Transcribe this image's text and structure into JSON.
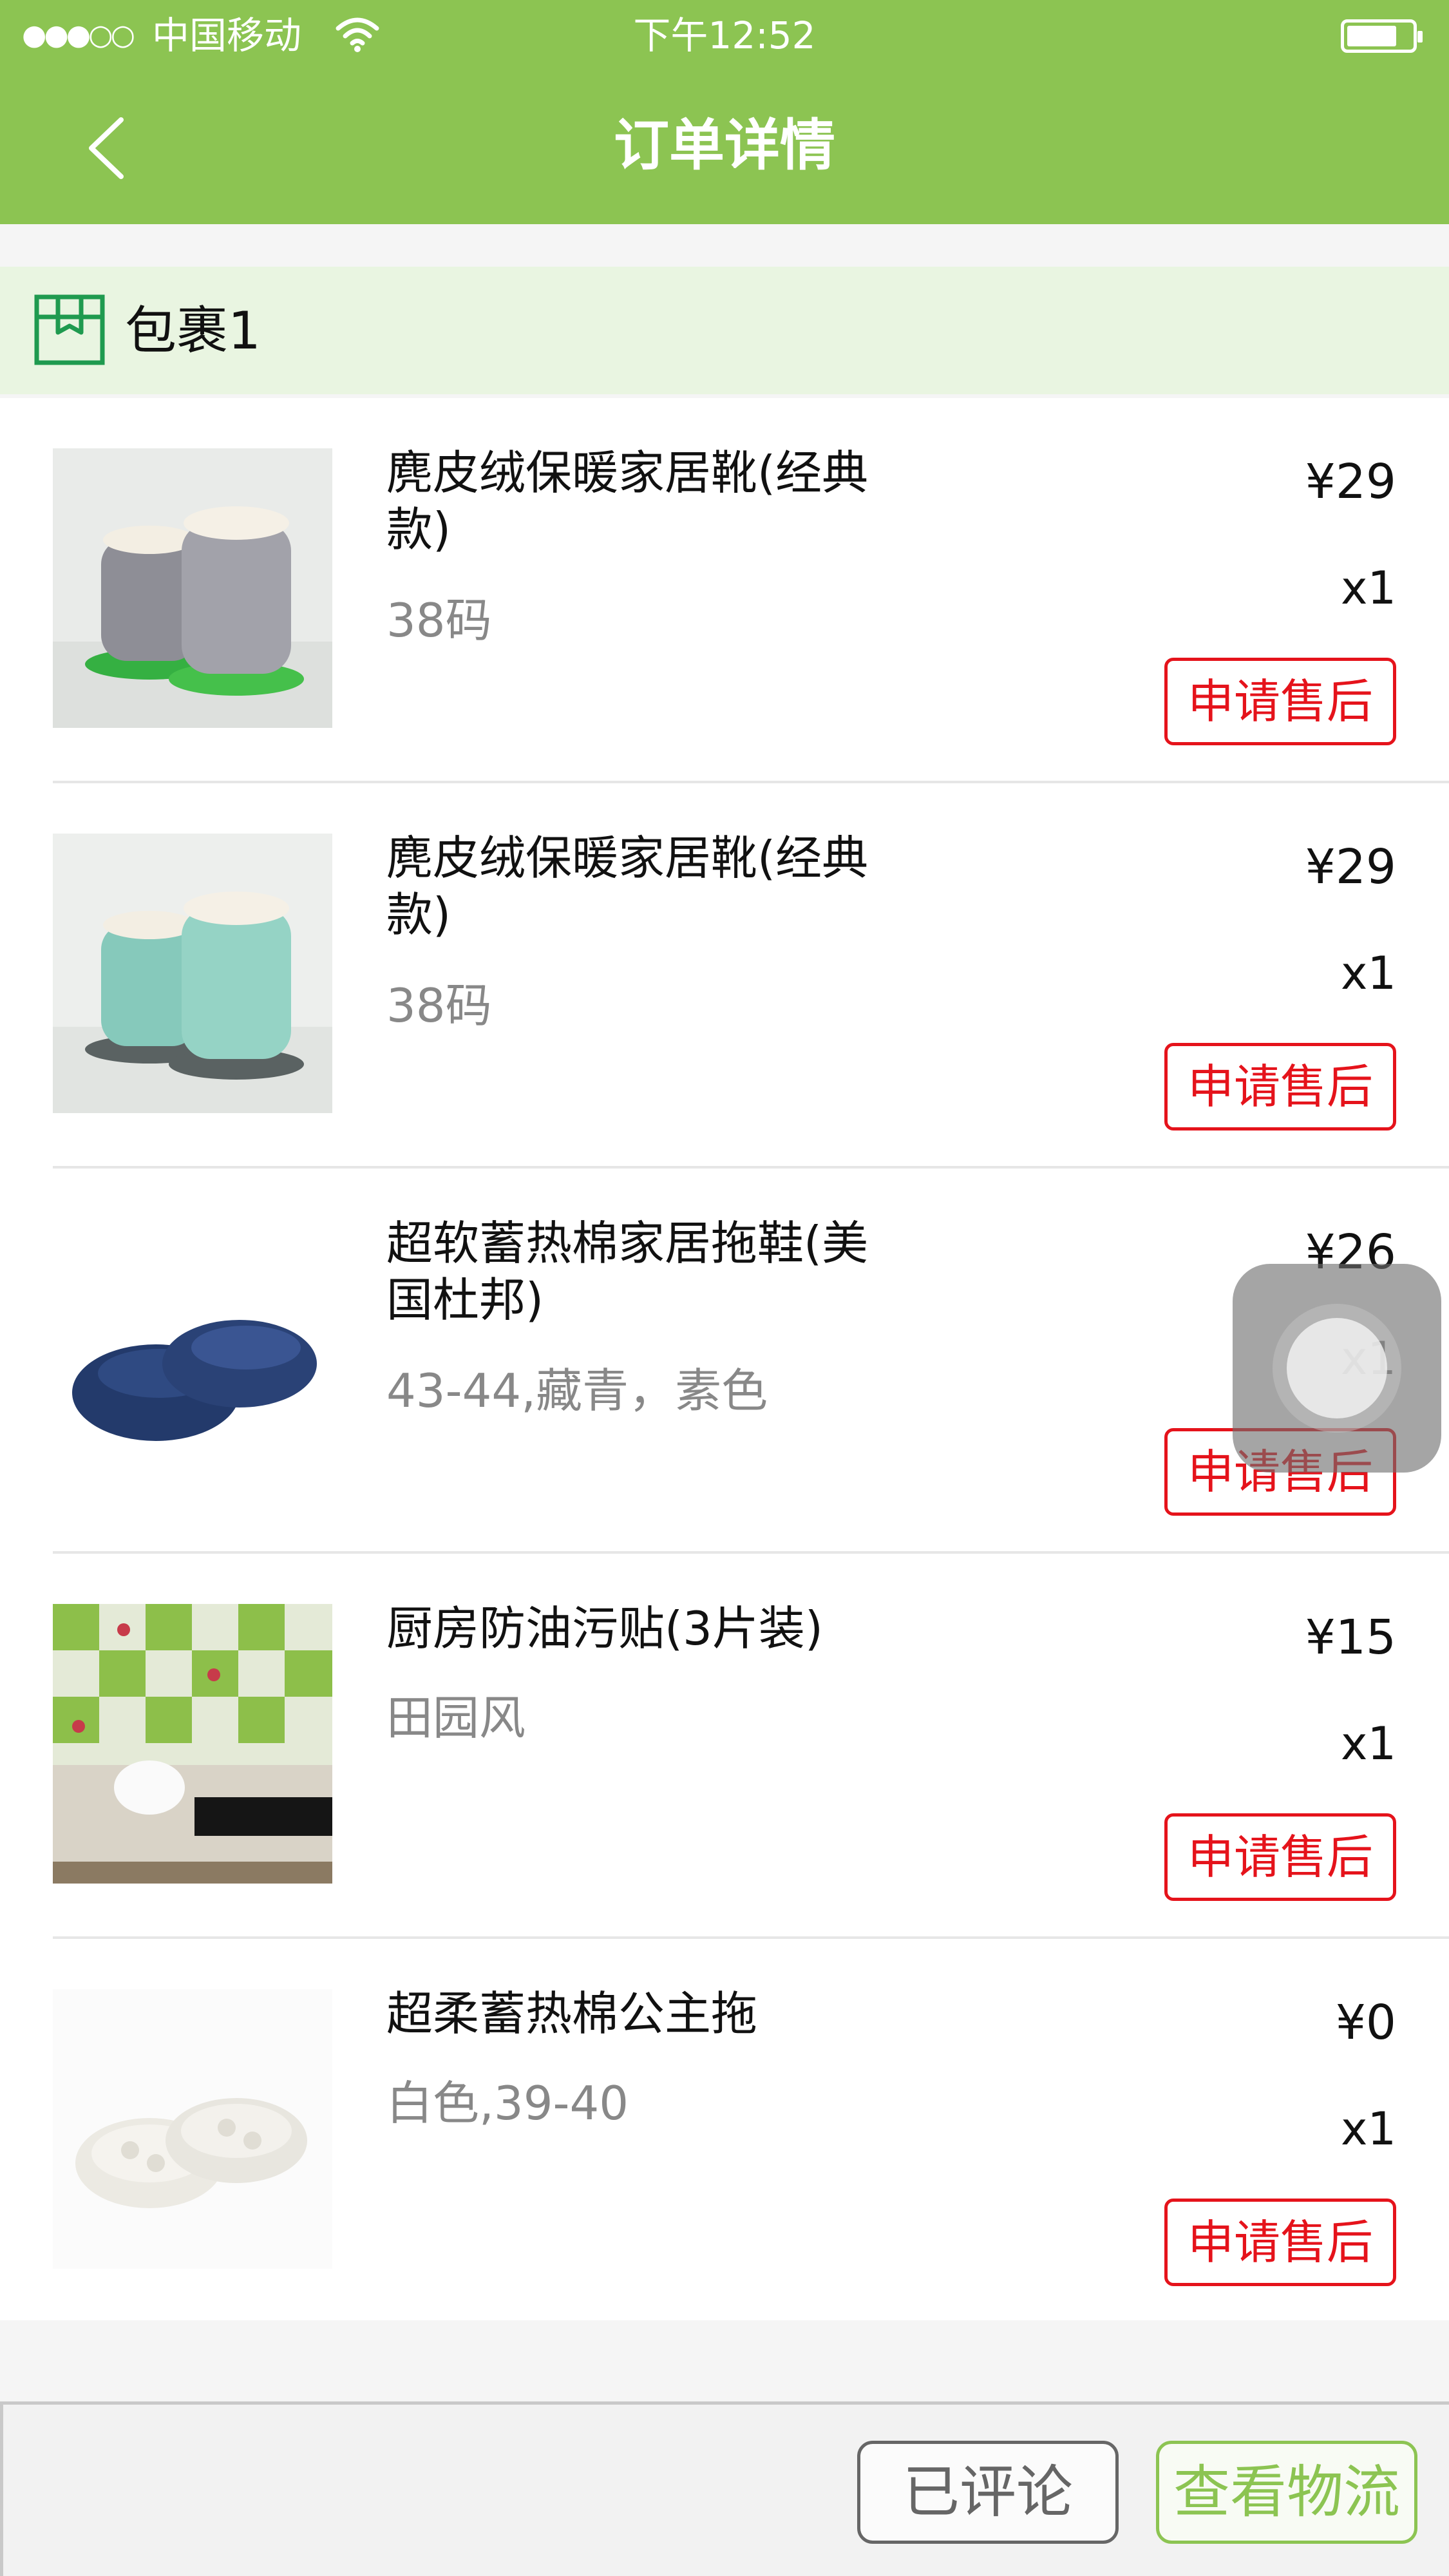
{
  "status_bar": {
    "signal": "●●●○○",
    "carrier": "中国移动",
    "time": "下午12:52"
  },
  "header": {
    "title": "订单详情",
    "back_icon": "chevron-left-icon"
  },
  "package": {
    "label": "包裹1",
    "icon": "package-icon"
  },
  "items": [
    {
      "name": "麂皮绒保暖家居靴(经典款)",
      "spec": "38码",
      "price": "¥29",
      "qty": "x1",
      "action": "申请售后",
      "image": "grey-fleece-boots"
    },
    {
      "name": "麂皮绒保暖家居靴(经典款)",
      "spec": "38码",
      "price": "¥29",
      "qty": "x1",
      "action": "申请售后",
      "image": "mint-fleece-boots"
    },
    {
      "name": "超软蓄热棉家居拖鞋(美国杜邦)",
      "spec": "43-44,藏青，素色",
      "price": "¥26",
      "qty": "x1",
      "action": "申请售后",
      "image": "navy-slippers"
    },
    {
      "name": "厨房防油污贴(3片装)",
      "spec": "田园风",
      "price": "¥15",
      "qty": "x1",
      "action": "申请售后",
      "image": "kitchen-tile-stickers"
    },
    {
      "name": "超柔蓄热棉公主拖",
      "spec": "白色,39-40",
      "price": "¥0",
      "qty": "x1",
      "action": "申请售后",
      "image": "white-princess-slippers"
    }
  ],
  "bottom_bar": {
    "reviewed_label": "已评论",
    "logistics_label": "查看物流"
  },
  "colors": {
    "brand_green": "#8cc452",
    "package_bar_bg": "#e9f5e1",
    "after_sale_red": "#e5131b",
    "spec_gray": "#888888"
  }
}
